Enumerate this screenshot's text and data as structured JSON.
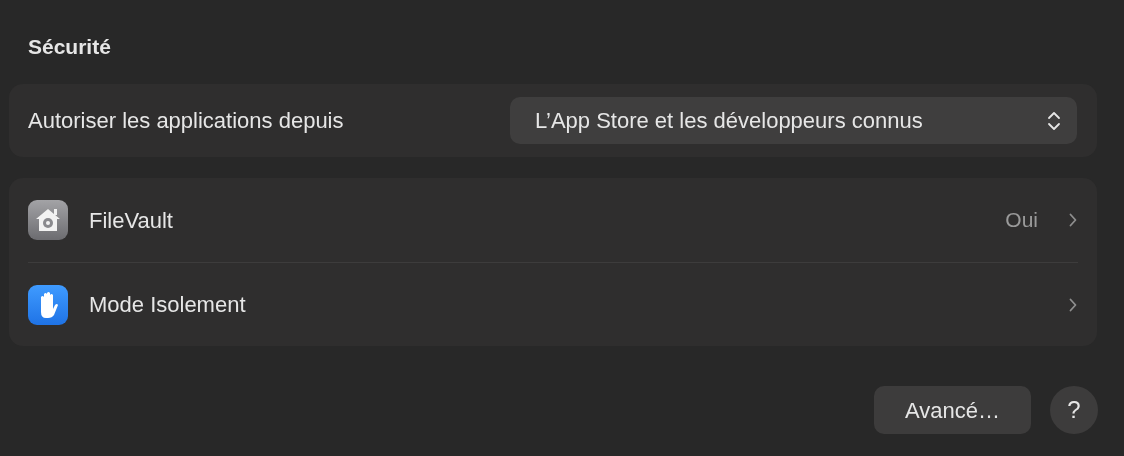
{
  "section_title": "Sécurité",
  "allow_apps": {
    "label": "Autoriser les applications depuis",
    "value": "L’App Store et les développeurs connus"
  },
  "rows": [
    {
      "kind": "vault",
      "label": "FileVault",
      "value": "Oui"
    },
    {
      "kind": "hand",
      "label": "Mode Isolement"
    }
  ],
  "buttons": {
    "advanced": "Avancé…",
    "help": "?"
  }
}
